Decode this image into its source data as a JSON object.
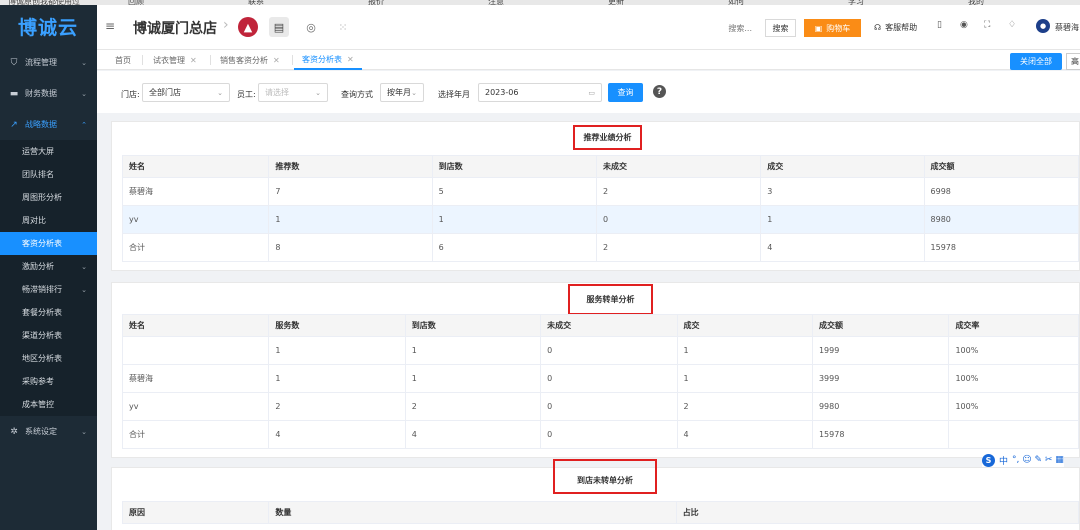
{
  "browser": {
    "bookmarks": [
      "博诚原创我都使用过",
      "回顾",
      "联系",
      "报价",
      "注意",
      "更新",
      "如何",
      "学习",
      "我的"
    ]
  },
  "sidebar": {
    "logo": "博诚云",
    "menu": [
      {
        "label": "流程管理",
        "icon": "filter-icon"
      },
      {
        "label": "财务数据",
        "icon": "wallet-icon"
      },
      {
        "label": "战略数据",
        "icon": "trend-icon"
      }
    ],
    "sub_items": [
      "运营大屏",
      "团队排名",
      "周图形分析",
      "周对比",
      "客资分析表",
      "激励分析",
      "畅滞销排行",
      "套餐分析表",
      "渠道分析表",
      "地区分析表",
      "采购参考",
      "成本管控"
    ],
    "system": {
      "label": "系统设定",
      "icon": "gear-icon"
    }
  },
  "header": {
    "store_name": "博诚厦门总店",
    "search_placeholder": "搜索...",
    "search_label": "搜索",
    "cart_label": "购物车",
    "help_label": "客服帮助",
    "user_name": "蔡碧海"
  },
  "tabs": {
    "items": [
      "首页",
      "试衣管理",
      "销售客资分析",
      "客资分析表"
    ],
    "active_index": 3,
    "close_all_label": "关闭全部",
    "more_label": "高"
  },
  "filter": {
    "store_label": "门店:",
    "store_value": "全部门店",
    "staff_label": "员工:",
    "staff_placeholder": "请选择",
    "query_mode_label": "查询方式",
    "query_mode_value": "按年月",
    "date_label": "选择年月",
    "date_value": "2023-06",
    "query_button": "查询",
    "help_icon": "?"
  },
  "recommend": {
    "title": "推荐业绩分析",
    "columns": [
      "姓名",
      "推荐数",
      "到店数",
      "未成交",
      "成交",
      "成交额"
    ],
    "rows": [
      [
        "蔡碧海",
        "7",
        "5",
        "2",
        "3",
        "6998"
      ],
      [
        "yv",
        "1",
        "1",
        "0",
        "1",
        "8980"
      ],
      [
        "合计",
        "8",
        "6",
        "2",
        "4",
        "15978"
      ]
    ]
  },
  "service": {
    "title": "服务转单分析",
    "columns": [
      "姓名",
      "服务数",
      "到店数",
      "未成交",
      "成交",
      "成交额",
      "成交率"
    ],
    "rows": [
      [
        "",
        "1",
        "1",
        "0",
        "1",
        "1999",
        "100%"
      ],
      [
        "蔡碧海",
        "1",
        "1",
        "0",
        "1",
        "3999",
        "100%"
      ],
      [
        "yv",
        "2",
        "2",
        "0",
        "2",
        "9980",
        "100%"
      ],
      [
        "合计",
        "4",
        "4",
        "0",
        "4",
        "15978",
        ""
      ]
    ]
  },
  "arrival": {
    "title": "到店未转单分析",
    "columns": [
      "原因",
      "数量",
      "占比"
    ]
  },
  "ime": {
    "label": "中",
    "marks": "°, ☺ ✎ ✂ ▦"
  },
  "colors": {
    "primary": "#1890ff",
    "sidebar_bg": "#1d2b36",
    "cart": "#fa8c16",
    "title_box": "#e02020"
  }
}
